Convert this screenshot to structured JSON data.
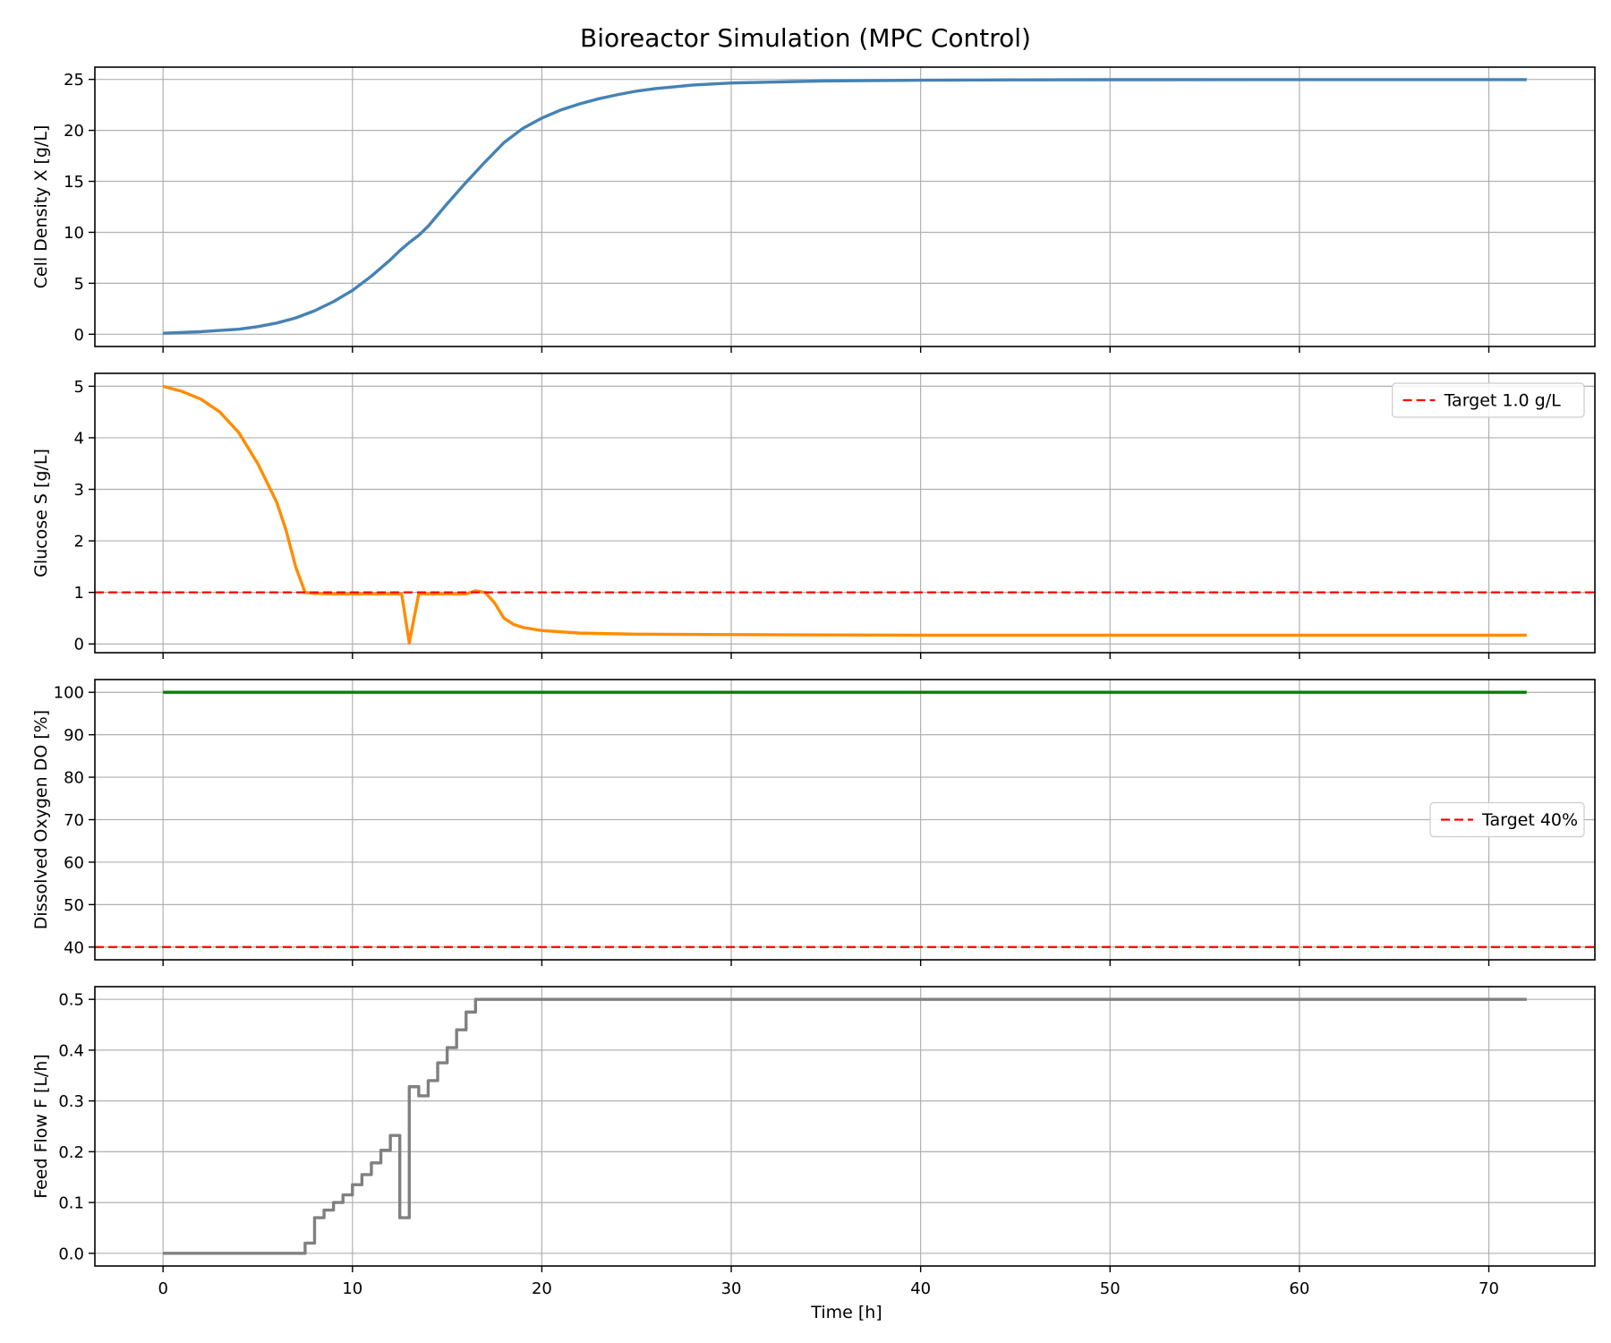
{
  "figure": {
    "title": "Bioreactor Simulation (MPC Control)",
    "xlabel": "Time [h]"
  },
  "chart_data": [
    {
      "type": "line",
      "ylabel": "Cell Density X [g/L]",
      "xlim": [
        -3.6,
        75.6
      ],
      "ylim": [
        -1.2,
        26.2
      ],
      "xticks": [
        0,
        10,
        20,
        30,
        40,
        50,
        60,
        70
      ],
      "yticks": [
        0,
        5,
        10,
        15,
        20,
        25
      ],
      "ytick_labels": [
        "0",
        "5",
        "10",
        "15",
        "20",
        "25"
      ],
      "grid": true,
      "legend": null,
      "series": [
        {
          "color": "#4682b4",
          "style": "solid",
          "x": [
            0,
            2,
            4,
            5,
            6,
            7,
            8,
            9,
            10,
            11,
            12,
            12.5,
            13,
            13.5,
            14,
            15,
            16,
            17,
            18,
            19,
            20,
            21,
            22,
            23,
            24,
            25,
            26,
            28,
            30,
            35,
            40,
            45,
            50,
            60,
            72
          ],
          "y": [
            0.1,
            0.25,
            0.5,
            0.75,
            1.1,
            1.6,
            2.3,
            3.2,
            4.3,
            5.7,
            7.3,
            8.2,
            9.0,
            9.7,
            10.6,
            12.8,
            14.9,
            16.9,
            18.8,
            20.2,
            21.2,
            22.0,
            22.6,
            23.1,
            23.5,
            23.85,
            24.1,
            24.45,
            24.65,
            24.85,
            24.92,
            24.95,
            24.97,
            24.98,
            24.98
          ]
        }
      ]
    },
    {
      "type": "line",
      "ylabel": "Glucose S [g/L]",
      "xlim": [
        -3.6,
        75.6
      ],
      "ylim": [
        -0.17,
        5.25
      ],
      "xticks": [
        0,
        10,
        20,
        30,
        40,
        50,
        60,
        70
      ],
      "yticks": [
        0,
        1,
        2,
        3,
        4,
        5
      ],
      "ytick_labels": [
        "0",
        "1",
        "2",
        "3",
        "4",
        "5"
      ],
      "grid": true,
      "legend": "upper right",
      "series": [
        {
          "color": "#ff8c00",
          "style": "solid",
          "x": [
            0,
            1,
            2,
            3,
            4,
            5,
            6,
            6.5,
            7,
            7.5,
            8,
            9,
            10,
            11,
            12,
            12.6,
            13,
            13.5,
            14,
            15,
            16,
            16.5,
            17,
            17.5,
            18,
            18.5,
            19,
            20,
            22,
            25,
            30,
            40,
            50,
            60,
            72
          ],
          "y": [
            5.0,
            4.9,
            4.75,
            4.5,
            4.1,
            3.5,
            2.75,
            2.2,
            1.5,
            1.0,
            0.98,
            0.97,
            0.97,
            0.97,
            0.97,
            0.97,
            0.02,
            0.97,
            0.97,
            0.97,
            0.97,
            1.03,
            1.0,
            0.8,
            0.5,
            0.38,
            0.32,
            0.26,
            0.21,
            0.19,
            0.18,
            0.17,
            0.17,
            0.17,
            0.17
          ]
        },
        {
          "name": "Target 1.0 g/L",
          "color": "#ff0000",
          "style": "dashed",
          "x": [
            -3.6,
            75.6
          ],
          "y": [
            1.0,
            1.0
          ]
        }
      ]
    },
    {
      "type": "line",
      "ylabel": "Dissolved Oxygen DO [%]",
      "xlim": [
        -3.6,
        75.6
      ],
      "ylim": [
        37.0,
        103.0
      ],
      "xticks": [
        0,
        10,
        20,
        30,
        40,
        50,
        60,
        70
      ],
      "yticks": [
        40,
        50,
        60,
        70,
        80,
        90,
        100
      ],
      "ytick_labels": [
        "40",
        "50",
        "60",
        "70",
        "80",
        "90",
        "100"
      ],
      "grid": true,
      "legend": "center right",
      "series": [
        {
          "color": "#008000",
          "style": "solid",
          "x": [
            0,
            72
          ],
          "y": [
            100,
            100
          ]
        },
        {
          "name": "Target 40%",
          "color": "#ff0000",
          "style": "dashed",
          "x": [
            -3.6,
            75.6
          ],
          "y": [
            40,
            40
          ]
        }
      ]
    },
    {
      "type": "line",
      "ylabel": "Feed Flow F [L/h]",
      "xlim": [
        -3.6,
        75.6
      ],
      "ylim": [
        -0.025,
        0.525
      ],
      "xticks": [
        0,
        10,
        20,
        30,
        40,
        50,
        60,
        70
      ],
      "xtick_labels": [
        "0",
        "10",
        "20",
        "30",
        "40",
        "50",
        "60",
        "70"
      ],
      "yticks": [
        0.0,
        0.1,
        0.2,
        0.3,
        0.4,
        0.5
      ],
      "ytick_labels": [
        "0.0",
        "0.1",
        "0.2",
        "0.3",
        "0.4",
        "0.5"
      ],
      "grid": true,
      "legend": null,
      "series": [
        {
          "color": "#808080",
          "style": "steps-post",
          "x": [
            0,
            7.5,
            8.0,
            8.5,
            9.0,
            9.5,
            10.0,
            10.5,
            11.0,
            11.5,
            12.0,
            12.5,
            13.0,
            13.5,
            14.0,
            14.5,
            15.0,
            15.5,
            16.0,
            16.5,
            72
          ],
          "y": [
            0.0,
            0.02,
            0.07,
            0.085,
            0.1,
            0.115,
            0.135,
            0.155,
            0.178,
            0.203,
            0.232,
            0.07,
            0.328,
            0.31,
            0.34,
            0.375,
            0.405,
            0.44,
            0.475,
            0.5,
            0.5
          ]
        }
      ]
    }
  ]
}
